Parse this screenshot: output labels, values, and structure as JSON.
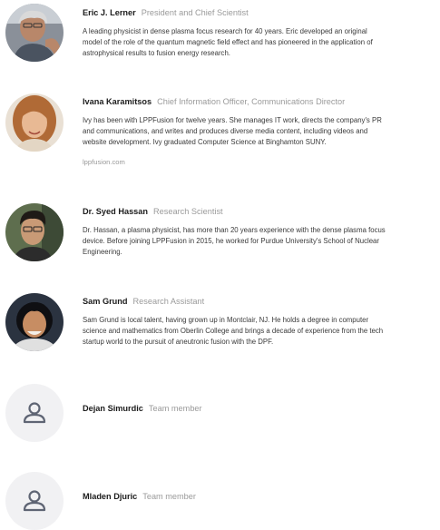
{
  "team": {
    "members": [
      {
        "name": "Eric J. Lerner",
        "role": "President and Chief Scientist",
        "bio_lines": [
          "A leading physicist in dense plasma focus research for 40 years. Eric developed an original",
          "model of the role of the quantum magnetic field effect and has pioneered in the application of",
          "astrophysical results to fusion energy research."
        ]
      },
      {
        "name": "Ivana Karamitsos",
        "role": "Chief Information Officer, Communications Director",
        "bio_lines": [
          "Ivy has been with LPPFusion for twelve years. She manages IT work, directs the company's PR",
          "and communications, and writes and produces diverse media content, including videos and",
          "website development. Ivy graduated Computer Science at Binghamton SUNY."
        ],
        "link": "lppfusion.com"
      },
      {
        "name": "Dr. Syed Hassan",
        "role": "Research Scientist",
        "bio_lines": [
          "Dr. Hassan, a plasma physicist, has more than 20 years experience with the dense plasma focus",
          "device. Before joining LPPFusion in 2015, he worked for Purdue University's School of Nuclear",
          "Engineering."
        ]
      },
      {
        "name": "Sam Grund",
        "role": "Research Assistant",
        "bio_lines": [
          "Sam Grund is local talent, having grown up in Montclair, NJ. He holds a degree in computer",
          "science and mathematics from Oberlin College and brings a decade of experience from the tech",
          "startup world to the pursuit of aneutronic fusion with the DPF."
        ]
      },
      {
        "name": "Dejan Simurdic",
        "role": "Team member"
      },
      {
        "name": "Mladen Djuric",
        "role": "Team member"
      }
    ]
  },
  "icons": {
    "placeholder": "user-icon"
  },
  "colors": {
    "name_text": "#1c1c1c",
    "role_text": "#9a9a9a",
    "bio_text": "#3a3a3a",
    "placeholder_bg": "#f1f1f3",
    "placeholder_icon": "#5f6574"
  }
}
